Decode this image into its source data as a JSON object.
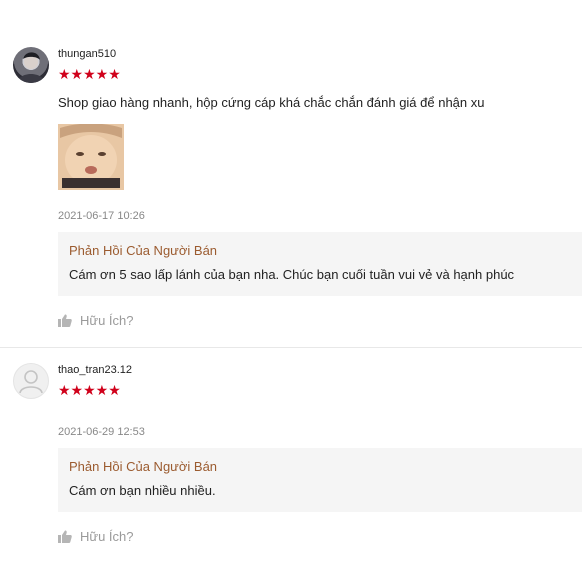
{
  "reviews": [
    {
      "username": "thungan510",
      "stars": "★★★★★",
      "comment": "Shop giao hàng nhanh, hộp cứng cáp khá chắc chắn đánh giá để nhận xu",
      "date": "2021-06-17 10:26",
      "reply_title": "Phản Hồi Của Người Bán",
      "reply_text": "Cám ơn 5 sao lấp lánh của bạn nha. Chúc bạn cuối tuần vui vẻ và hạnh phúc",
      "helpful_label": "Hữu Ích?"
    },
    {
      "username": "thao_tran23.12",
      "stars": "★★★★★",
      "date": "2021-06-29 12:53",
      "reply_title": "Phản Hồi Của Người Bán",
      "reply_text": "Cám ơn bạn nhiều nhiều.",
      "helpful_label": "Hữu Ích?"
    }
  ],
  "colors": {
    "star": "#d0011b",
    "reply_title": "#9b5b2f",
    "reply_bg": "#f5f5f5"
  }
}
